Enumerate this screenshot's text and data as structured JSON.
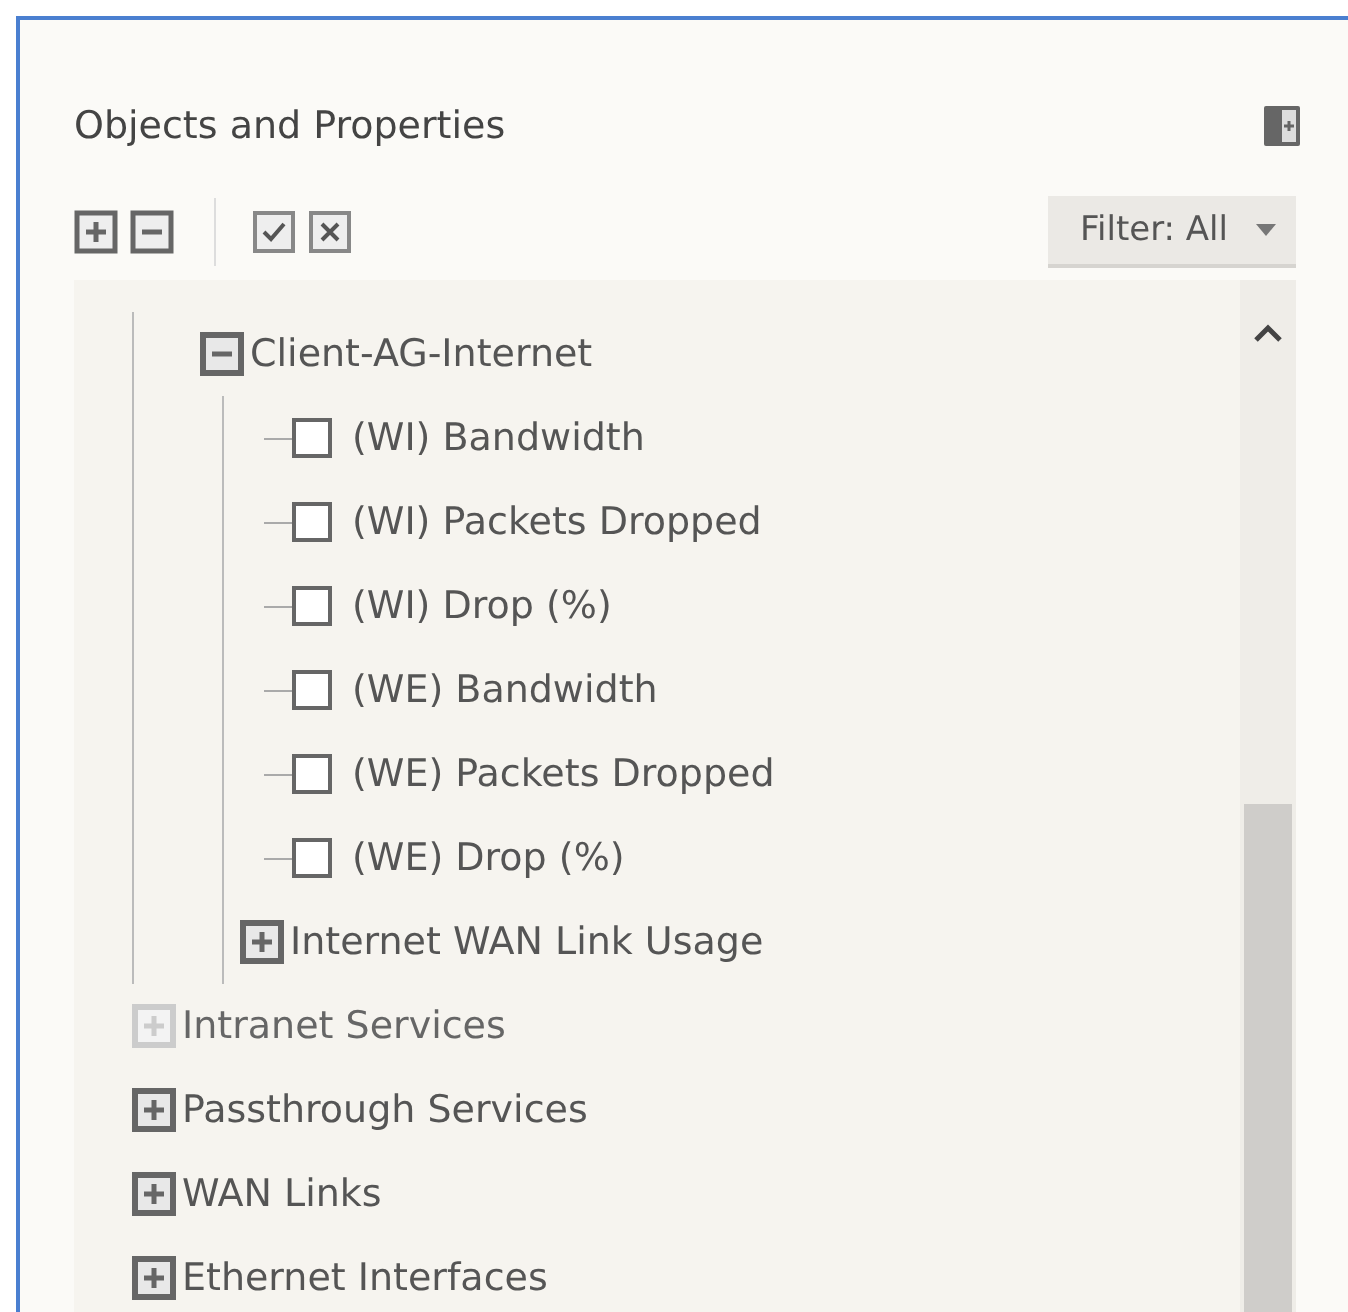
{
  "panel": {
    "title": "Objects and Properties"
  },
  "toolbar": {
    "filter": "Filter: All"
  },
  "tree": {
    "scrolled_parent_children": [
      {
        "label": "Client-AG-Internet",
        "kind": "group",
        "expanded": true,
        "disabled": false,
        "children": [
          {
            "label": "(WI) Bandwidth",
            "kind": "check",
            "checked": false
          },
          {
            "label": "(WI) Packets Dropped",
            "kind": "check",
            "checked": false
          },
          {
            "label": "(WI) Drop (%)",
            "kind": "check",
            "checked": false
          },
          {
            "label": "(WE) Bandwidth",
            "kind": "check",
            "checked": false
          },
          {
            "label": "(WE) Packets Dropped",
            "kind": "check",
            "checked": false
          },
          {
            "label": "(WE) Drop (%)",
            "kind": "check",
            "checked": false
          },
          {
            "label": "Internet WAN Link Usage",
            "kind": "group",
            "expanded": false,
            "disabled": false
          }
        ]
      }
    ],
    "items": [
      {
        "label": "Intranet Services",
        "kind": "group",
        "expanded": false,
        "disabled": true
      },
      {
        "label": "Passthrough Services",
        "kind": "group",
        "expanded": false,
        "disabled": false
      },
      {
        "label": "WAN Links",
        "kind": "group",
        "expanded": false,
        "disabled": false
      },
      {
        "label": "Ethernet Interfaces",
        "kind": "group",
        "expanded": false,
        "disabled": false
      }
    ]
  }
}
